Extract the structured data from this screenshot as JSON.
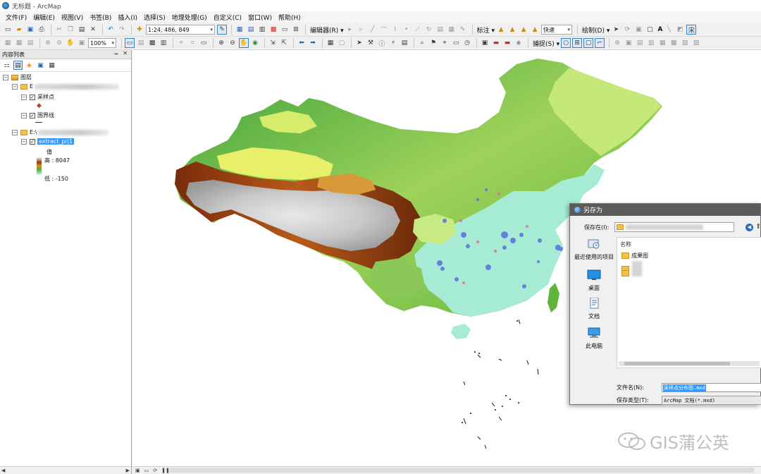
{
  "window": {
    "title": "无标题 - ArcMap"
  },
  "menubar": [
    "文件(F)",
    "编辑(E)",
    "视图(V)",
    "书签(B)",
    "插入(I)",
    "选择(S)",
    "地理处理(G)",
    "自定义(C)",
    "窗口(W)",
    "帮助(H)"
  ],
  "toolbar1": {
    "scale_value": "1:24, 486, 849",
    "editor_label": "编辑器(R) ▾",
    "annotation_label": "标注 ▾",
    "speed_value": "快速",
    "draw_label": "绘制(D) ▾",
    "font_label": "A",
    "right_label": "宋"
  },
  "toolbar2": {
    "zoom_value": "100%",
    "snapping_label": "捕捉(S) ▾"
  },
  "toc": {
    "title": "内容列表",
    "pin_glyphs": "🗕 ✕",
    "root_label": "图层",
    "group1_prefix": "E",
    "layer_sampling": "采样点",
    "layer_border": "国界线",
    "group2_prefix": "E:\\",
    "layer_raster": "extract_prj1",
    "legend_title": "值",
    "legend_high": "高 : 8047",
    "legend_low": "低 : -150"
  },
  "dialog": {
    "title": "另存为",
    "save_in_label": "保存在(I):",
    "column_name": "名称",
    "places": [
      "最近使用的项目",
      "桌面",
      "文档",
      "此电脑"
    ],
    "folder_item": "成果图",
    "filename_label": "文件名(N):",
    "filename_value": "采样点分布图.mxd",
    "filetype_label": "保存类型(T):",
    "filetype_value": "ArcMap 文档(*.mxd)"
  },
  "watermark": {
    "text": "GIS蒲公英"
  },
  "colors": {
    "accent": "#3399ff",
    "dialog_title": "#5a5a5a",
    "dem_high": "#f4f4f4",
    "dem_mid_high": "#8b3a0f",
    "dem_mid": "#58a838",
    "dem_low": "#a8e8d8"
  }
}
